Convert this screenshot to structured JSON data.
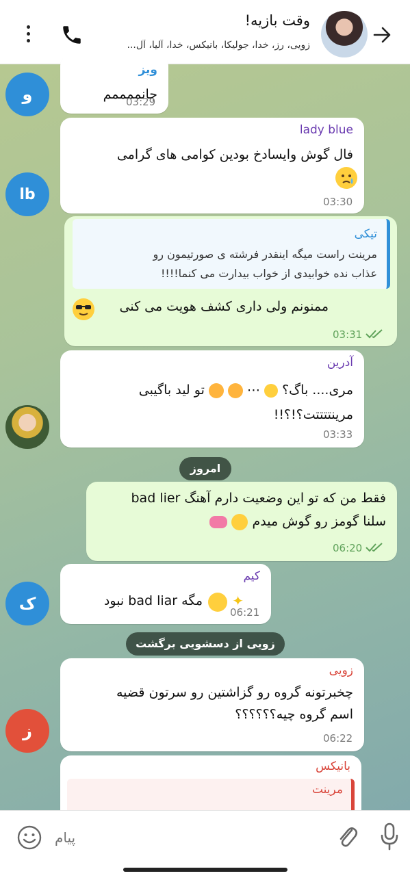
{
  "header": {
    "title": "وقت بازیه!",
    "subtitle": "زویی، رز، خدا، جولیکا، بانیکس، خدا، آلیا، آل..."
  },
  "messages": {
    "m1": {
      "sender": "ویز",
      "avatar_letter": "و",
      "avatar_color": "#2f8fd8",
      "text": "جانممممم",
      "time": "03:29"
    },
    "m2": {
      "sender": "lady blue",
      "avatar_letter": "lb",
      "avatar_color": "#2f8fd8",
      "text": "فال گوش وایسادخ بودین کوامی های گرامی",
      "time": "03:30"
    },
    "m3": {
      "reply_sender": "تیکی",
      "reply_text_1": "مرینت راست میگه اینقدر فرشته ی صورتیمون رو",
      "reply_text_2": "عذاب نده خوابیدی از خواب بیدارت می کنما!!!!",
      "text": "ممنونم ولی داری کشف هویت می کنی",
      "time": "03:31"
    },
    "m4": {
      "sender": "آدرین",
      "line1": "مری.... باگ؟",
      "line1b": "تو لید باگیبی",
      "line2": "مرینتتتتت؟!؟!!",
      "time": "03:33"
    },
    "date_pill": "امروز",
    "m5": {
      "line1": "فقط من که تو این وضعیت دارم آهنگ bad lier",
      "line2": "سلنا گومز رو گوش میدم",
      "time": "06:20"
    },
    "m6": {
      "sender": "کیم",
      "avatar_letter": "ک",
      "avatar_color": "#2f8fd8",
      "text": "مگه bad liar نبود",
      "time": "06:21"
    },
    "service": "زویی از دسشویی برگشت",
    "m7": {
      "sender": "زویی",
      "avatar_letter": "ز",
      "avatar_color": "#e2503a",
      "line1": "چخبرتونه گروه رو گزاشتین رو سرتون قضیه",
      "line2": "اسم گروه چیه؟؟؟؟؟؟",
      "time": "06:22"
    },
    "m8": {
      "sender": "بانیکس",
      "reply_sender": "مرینت"
    }
  },
  "input": {
    "placeholder": "پیام"
  },
  "colors": {
    "sender_purple": "#6a3bb0",
    "sender_red": "#d9453a",
    "sender_blue": "#2f8fd8",
    "out_bubble": "#e7fbd7",
    "tick_green": "#5fa25a"
  },
  "icons": [
    "arrow-right-icon",
    "phone-icon",
    "more-vertical-icon",
    "emoji-icon",
    "attach-icon",
    "mic-icon",
    "double-check-icon"
  ]
}
